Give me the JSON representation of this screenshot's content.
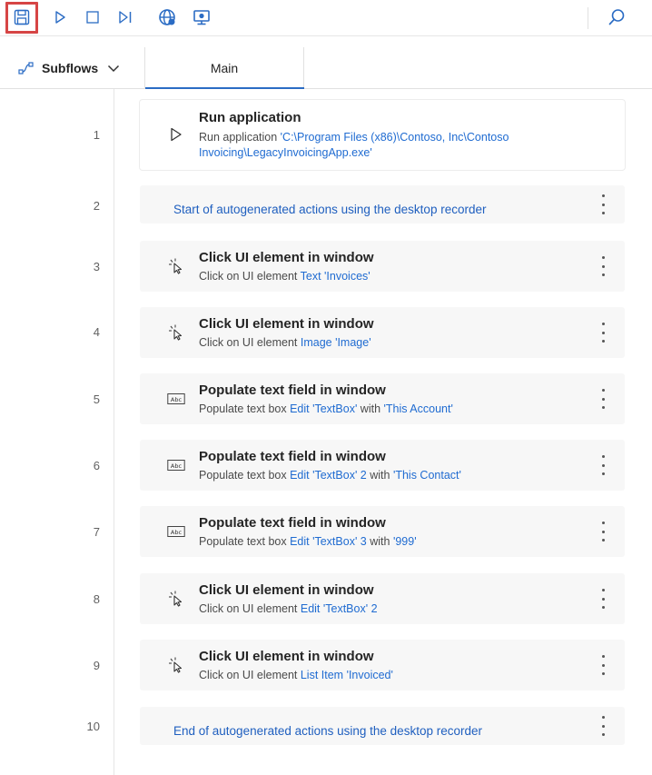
{
  "tabs": {
    "subflows_label": "Subflows",
    "main_label": "Main"
  },
  "colors": {
    "accent": "#2b6cc4",
    "highlight_border": "#d64545",
    "link_text": "#1f6bd1"
  },
  "toolbar_icons": [
    "save-icon",
    "run-icon",
    "stop-icon",
    "run-next-action-icon",
    "web-recorder-icon",
    "desktop-recorder-icon",
    "search-icon"
  ],
  "actions": [
    {
      "line": "1",
      "title": "Run application",
      "desc_prefix": "Run application ",
      "desc_value": "'C:\\Program Files (x86)\\Contoso, Inc\\Contoso Invoicing\\LegacyInvoicingApp.exe'"
    },
    {
      "line": "2",
      "comment": "Start of autogenerated actions using the desktop recorder"
    },
    {
      "line": "3",
      "title": "Click UI element in window",
      "desc_prefix": "Click on UI element ",
      "desc_value": "Text 'Invoices'"
    },
    {
      "line": "4",
      "title": "Click UI element in window",
      "desc_prefix": "Click on UI element ",
      "desc_value": "Image 'Image'"
    },
    {
      "line": "5",
      "title": "Populate text field in window",
      "desc_prefix": "Populate text box ",
      "desc_value": "Edit 'TextBox'",
      "desc_mid": " with ",
      "desc_value2": "'This Account'"
    },
    {
      "line": "6",
      "title": "Populate text field in window",
      "desc_prefix": "Populate text box ",
      "desc_value": "Edit 'TextBox' 2",
      "desc_mid": " with ",
      "desc_value2": "'This Contact'"
    },
    {
      "line": "7",
      "title": "Populate text field in window",
      "desc_prefix": "Populate text box ",
      "desc_value": "Edit 'TextBox' 3",
      "desc_mid": " with ",
      "desc_value2": "'999'"
    },
    {
      "line": "8",
      "title": "Click UI element in window",
      "desc_prefix": "Click on UI element ",
      "desc_value": "Edit 'TextBox' 2"
    },
    {
      "line": "9",
      "title": "Click UI element in window",
      "desc_prefix": "Click on UI element ",
      "desc_value": "List Item 'Invoiced'"
    },
    {
      "line": "10",
      "comment": "End of autogenerated actions using the desktop recorder"
    }
  ]
}
